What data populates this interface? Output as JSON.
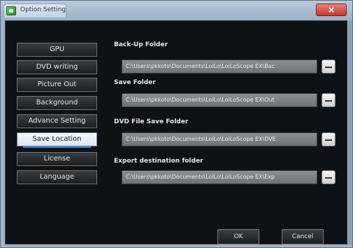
{
  "window": {
    "title": "Option Setting",
    "close_label": "×"
  },
  "sidebar": {
    "items": [
      {
        "label": "GPU"
      },
      {
        "label": "DVD writing"
      },
      {
        "label": "Picture Out"
      },
      {
        "label": "Background"
      },
      {
        "label": "Advance Setting"
      },
      {
        "label": "Save Location",
        "selected": true
      },
      {
        "label": "License"
      },
      {
        "label": "Language"
      }
    ]
  },
  "folders": [
    {
      "label": "Back-Up Folder",
      "path": "C:\\Users\\pkkoto\\Documents\\LoiLo\\LoiLoScope EX\\Bac"
    },
    {
      "label": "Save Folder",
      "path": "C:\\Users\\pkkoto\\Documents\\LoiLo\\LoiLoScope EX\\Out"
    },
    {
      "label": "DVD File Save Folder",
      "path": "C:\\Users\\pkkoto\\Documents\\LoiLo\\LoiLoScope EX\\DVE"
    },
    {
      "label": "Export destination folder",
      "path": "C:\\Users\\pkkoto\\Documents\\LoiLo\\LoiLoScope EX\\Exp"
    }
  ],
  "browse_label": "...",
  "buttons": {
    "ok": "OK",
    "cancel": "Cancel"
  },
  "colors": {
    "titlebar": "#9cb1c8",
    "client_bg": "#0f1214",
    "selected_accent": "#3b8fe0",
    "close_button": "#c23a2b"
  }
}
